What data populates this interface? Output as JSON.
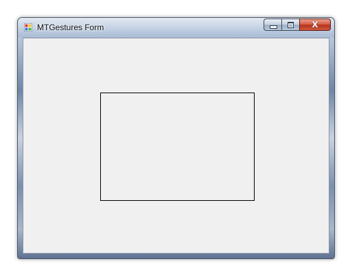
{
  "window": {
    "title": "MTGestures Form"
  },
  "caption_buttons": {
    "minimize_icon": "minimize-icon",
    "maximize_icon": "maximize-icon",
    "close_glyph": "X"
  },
  "colors": {
    "client_background": "#f0f0f0",
    "panel_border": "#000000",
    "close_button": "#c9462c"
  }
}
